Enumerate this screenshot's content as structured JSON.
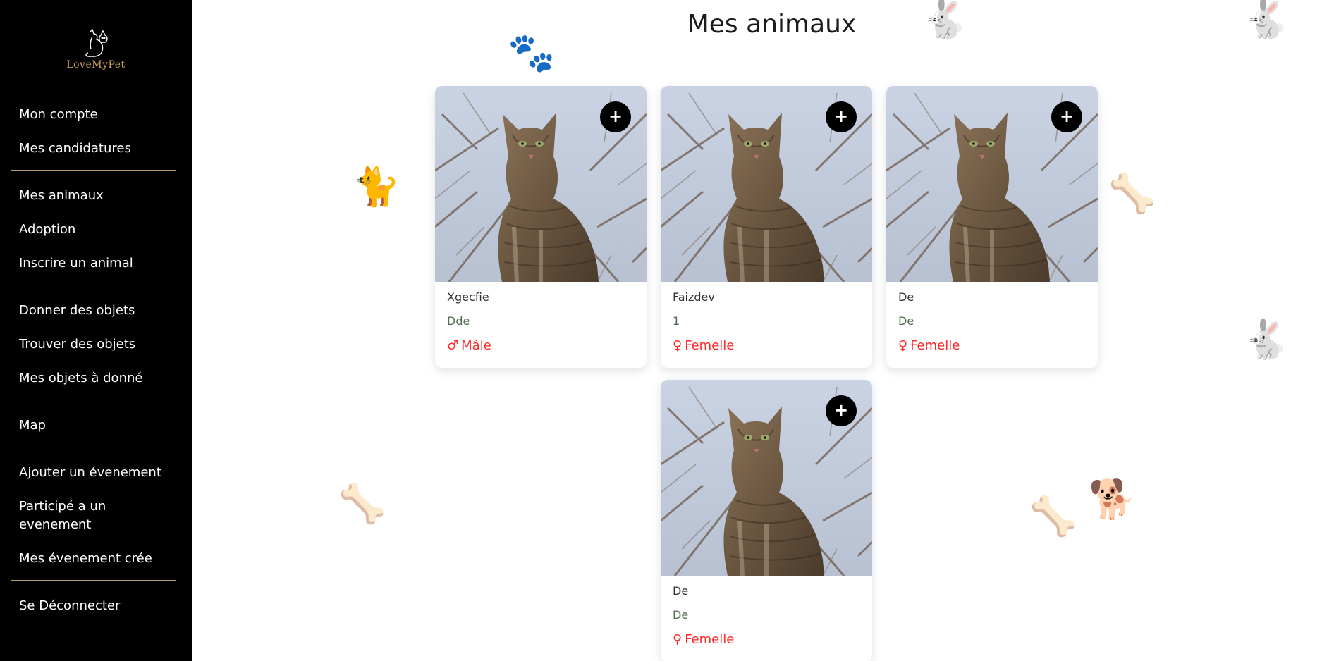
{
  "brand": {
    "logo_text": "LoveMyPet"
  },
  "sidebar": {
    "groups": [
      [
        {
          "label": "Mon compte"
        },
        {
          "label": "Mes candidatures"
        }
      ],
      [
        {
          "label": "Mes animaux"
        },
        {
          "label": "Adoption"
        },
        {
          "label": "Inscrire un animal"
        }
      ],
      [
        {
          "label": "Donner des objets"
        },
        {
          "label": "Trouver des objets"
        },
        {
          "label": "Mes objets à donné"
        }
      ],
      [
        {
          "label": "Map"
        }
      ],
      [
        {
          "label": "Ajouter un évenement"
        },
        {
          "label": "Participé a un evenement"
        },
        {
          "label": "Mes évenement crée"
        }
      ],
      [
        {
          "label": "Se Déconnecter"
        }
      ]
    ]
  },
  "main": {
    "title": "Mes animaux",
    "add_button_icon": "plus-icon",
    "pets": [
      {
        "name": "Xgecfie",
        "breed": "Dde",
        "gender": "Mâle",
        "gender_icon": "male-icon",
        "gender_symbol": "♂"
      },
      {
        "name": "Faizdev",
        "breed": "1",
        "gender": "Femelle",
        "gender_icon": "female-icon",
        "gender_symbol": "♀"
      },
      {
        "name": "De",
        "breed": "De",
        "gender": "Femelle",
        "gender_icon": "female-icon",
        "gender_symbol": "♀"
      },
      {
        "name": "De",
        "breed": "De",
        "gender": "Femelle",
        "gender_icon": "female-icon",
        "gender_symbol": "♀"
      }
    ]
  },
  "colors": {
    "sidebar_bg": "#000000",
    "separator": "#b59a6a",
    "gender_accent": "#ff2a2a",
    "logo_gold": "#c9a45a"
  }
}
